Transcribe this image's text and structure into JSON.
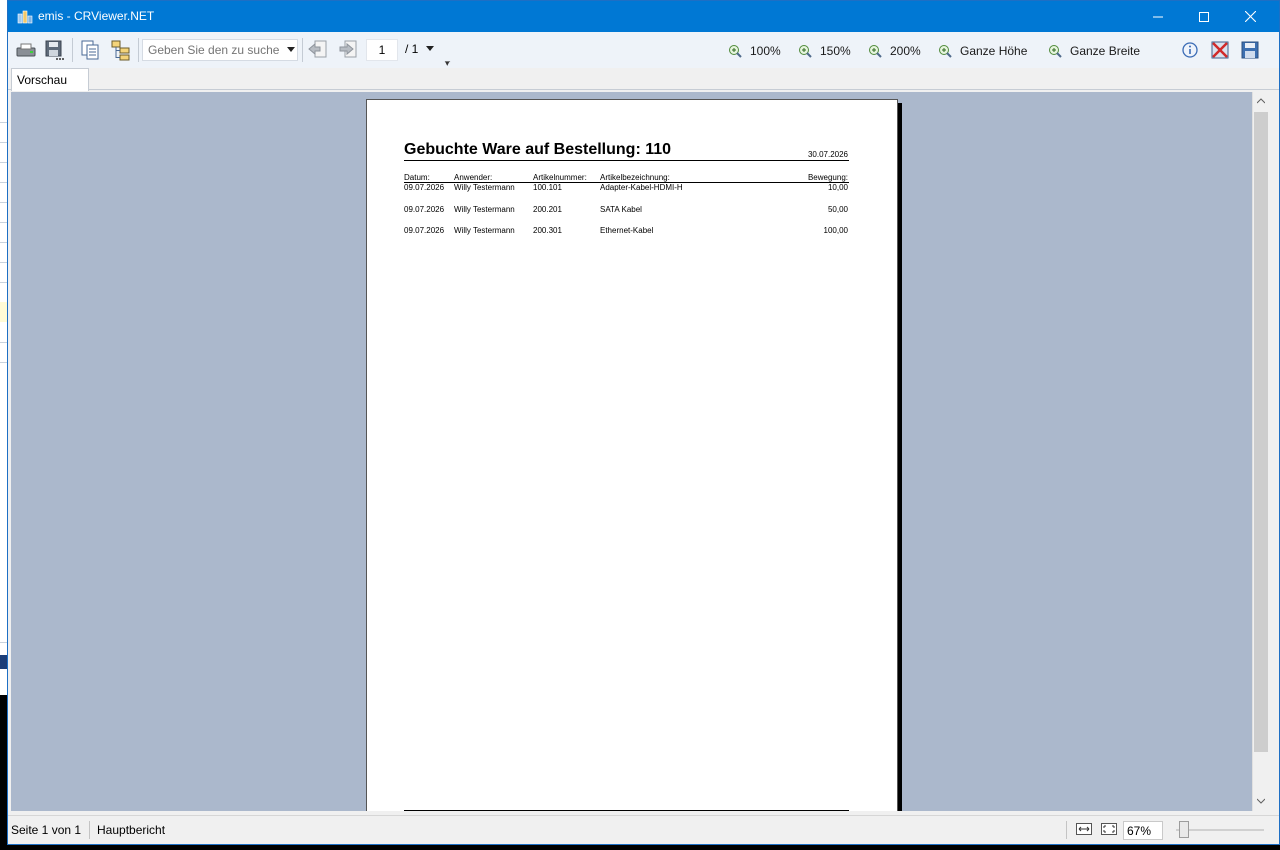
{
  "window": {
    "title": "emis - CRViewer.NET",
    "accent": "#0078d4"
  },
  "toolbar": {
    "search_placeholder": "Geben Sie den zu suchenden Text ein",
    "page_number": "1",
    "page_total": "/ 1",
    "zoom": [
      {
        "label": "100%"
      },
      {
        "label": "150%"
      },
      {
        "label": "200%"
      },
      {
        "label": "Ganze Höhe"
      },
      {
        "label": "Ganze Breite"
      }
    ]
  },
  "tabs": [
    {
      "label": "Vorschau"
    }
  ],
  "report": {
    "title": "Gebuchte Ware auf Bestellung: 110",
    "date": "30.07.2026",
    "columns": {
      "datum": "Datum:",
      "anwender": "Anwender:",
      "artikelnummer": "Artikelnummer:",
      "artikelbezeichnung": "Artikelbezeichnung:",
      "bewegung": "Bewegung:"
    },
    "rows": [
      {
        "datum": "09.07.2026",
        "anwender": "Willy Testermann",
        "artikelnummer": "100.101",
        "artikelbezeichnung": "Adapter-Kabel-HDMI-H",
        "bewegung": "10,00"
      },
      {
        "datum": "09.07.2026",
        "anwender": "Willy Testermann",
        "artikelnummer": "200.201",
        "artikelbezeichnung": "SATA Kabel",
        "bewegung": "50,00"
      },
      {
        "datum": "09.07.2026",
        "anwender": "Willy Testermann",
        "artikelnummer": "200.301",
        "artikelbezeichnung": "Ethernet-Kabel",
        "bewegung": "100,00"
      }
    ]
  },
  "statusbar": {
    "page_info": "Seite 1 von 1",
    "report_name": "Hauptbericht",
    "zoom_value": "67%"
  }
}
